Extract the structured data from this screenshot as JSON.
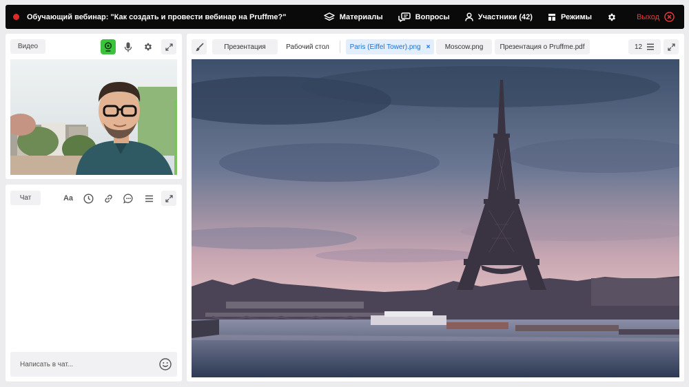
{
  "topbar": {
    "title": "Обучающий вебинар: \"Как создать и провести вебинар на Pruffme?\"",
    "materials_label": "Материалы",
    "questions_label": "Вопросы",
    "participants_label": "Участники (42)",
    "modes_label": "Режимы",
    "exit_label": "Выход"
  },
  "video": {
    "label": "Видео"
  },
  "chat": {
    "label": "Чат",
    "font_label": "Aa",
    "input_placeholder": "Написать в чат..."
  },
  "tabs": {
    "presentation": "Презентация",
    "desktop": "Рабочий стол",
    "files": [
      {
        "label": "Paris (Eiffel Tower).png",
        "active": true
      },
      {
        "label": "Moscow.png",
        "active": false
      },
      {
        "label": "Презентация о Pruffme.pdf",
        "active": false
      }
    ],
    "close_glyph": "×",
    "page_count": "12"
  },
  "colors": {
    "topbar_bg": "#0a0a0b",
    "accent_blue": "#1f6fd1",
    "exit_red": "#e53935",
    "active_green": "#3cc23c"
  }
}
